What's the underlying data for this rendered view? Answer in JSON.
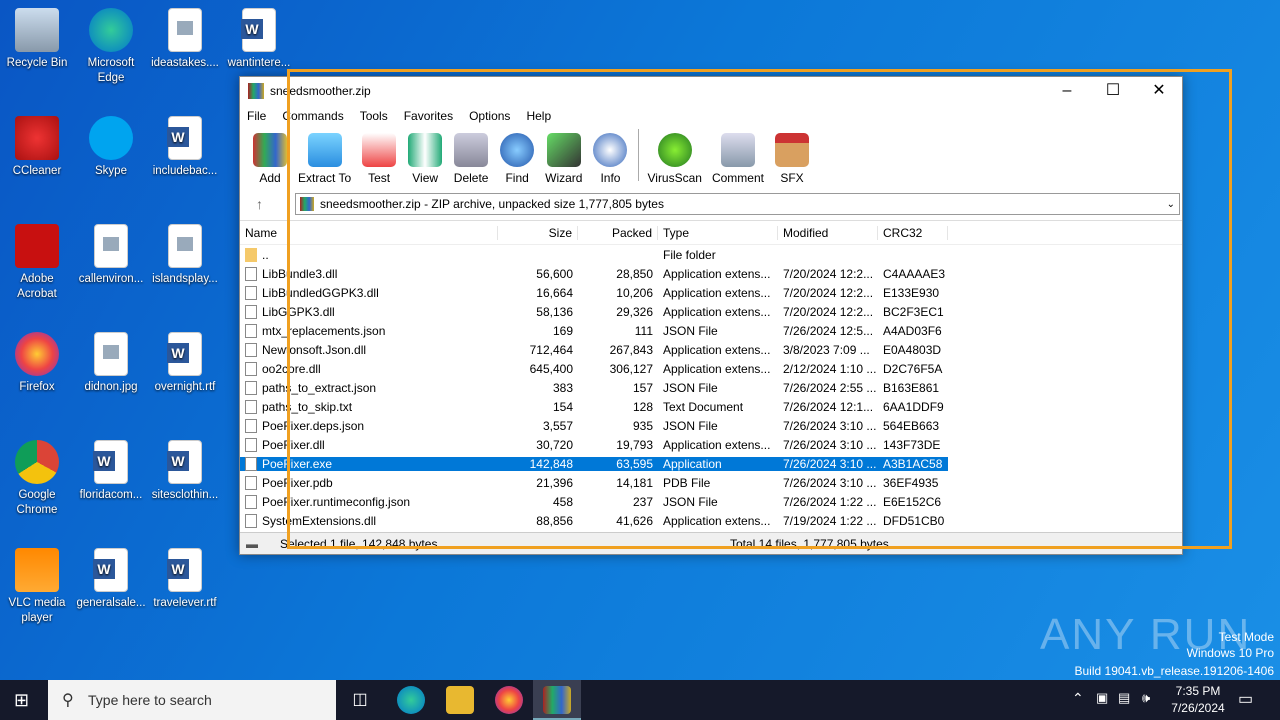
{
  "desktop": {
    "icons": [
      {
        "label": "Recycle Bin",
        "icon": "recycle-bin-icon"
      },
      {
        "label": "Microsoft Edge",
        "icon": "edge-icon"
      },
      {
        "label": "ideastakes....",
        "icon": "image-file-icon"
      },
      {
        "label": "wantintere...",
        "icon": "word-doc-icon"
      },
      {
        "label": "CCleaner",
        "icon": "ccleaner-icon"
      },
      {
        "label": "Skype",
        "icon": "skype-icon"
      },
      {
        "label": "includebac...",
        "icon": "word-doc-icon"
      },
      {
        "label": "Adobe Acrobat",
        "icon": "acrobat-icon"
      },
      {
        "label": "callenviron...",
        "icon": "image-file-icon"
      },
      {
        "label": "islandsplay...",
        "icon": "image-file-icon"
      },
      {
        "label": "Firefox",
        "icon": "firefox-icon"
      },
      {
        "label": "didnon.jpg",
        "icon": "image-file-icon"
      },
      {
        "label": "overnight.rtf",
        "icon": "word-doc-icon"
      },
      {
        "label": "Google Chrome",
        "icon": "chrome-icon"
      },
      {
        "label": "floridacom...",
        "icon": "word-doc-icon"
      },
      {
        "label": "sitesclothin...",
        "icon": "word-doc-icon"
      },
      {
        "label": "VLC media player",
        "icon": "vlc-icon"
      },
      {
        "label": "generalsale...",
        "icon": "word-doc-icon"
      },
      {
        "label": "travelever.rtf",
        "icon": "word-doc-icon"
      }
    ]
  },
  "window": {
    "title": "sneedsmoother.zip",
    "menu": [
      "File",
      "Commands",
      "Tools",
      "Favorites",
      "Options",
      "Help"
    ],
    "toolbar": [
      "Add",
      "Extract To",
      "Test",
      "View",
      "Delete",
      "Find",
      "Wizard",
      "Info",
      "VirusScan",
      "Comment",
      "SFX"
    ],
    "address": "sneedsmoother.zip - ZIP archive, unpacked size 1,777,805 bytes",
    "columns": [
      "Name",
      "Size",
      "Packed",
      "Type",
      "Modified",
      "CRC32"
    ],
    "rows": [
      [
        "..",
        "",
        "",
        "File folder",
        "",
        ""
      ],
      [
        "LibBundle3.dll",
        "56,600",
        "28,850",
        "Application extens...",
        "7/20/2024 12:2...",
        "C4AAAAE3"
      ],
      [
        "LibBundledGGPK3.dll",
        "16,664",
        "10,206",
        "Application extens...",
        "7/20/2024 12:2...",
        "E133E930"
      ],
      [
        "LibGGPK3.dll",
        "58,136",
        "29,326",
        "Application extens...",
        "7/20/2024 12:2...",
        "BC2F3EC1"
      ],
      [
        "mtx_replacements.json",
        "169",
        "111",
        "JSON File",
        "7/26/2024 12:5...",
        "A4AD03F6"
      ],
      [
        "Newtonsoft.Json.dll",
        "712,464",
        "267,843",
        "Application extens...",
        "3/8/2023 7:09 ...",
        "E0A4803D"
      ],
      [
        "oo2core.dll",
        "645,400",
        "306,127",
        "Application extens...",
        "2/12/2024 1:10 ...",
        "D2C76F5A"
      ],
      [
        "paths_to_extract.json",
        "383",
        "157",
        "JSON File",
        "7/26/2024 2:55 ...",
        "B163E861"
      ],
      [
        "paths_to_skip.txt",
        "154",
        "128",
        "Text Document",
        "7/26/2024 12:1...",
        "6AA1DDF9"
      ],
      [
        "PoeFixer.deps.json",
        "3,557",
        "935",
        "JSON File",
        "7/26/2024 3:10 ...",
        "564EB663"
      ],
      [
        "PoeFixer.dll",
        "30,720",
        "19,793",
        "Application extens...",
        "7/26/2024 3:10 ...",
        "143F73DE"
      ],
      [
        "PoeFixer.exe",
        "142,848",
        "63,595",
        "Application",
        "7/26/2024 3:10 ...",
        "A3B1AC58"
      ],
      [
        "PoeFixer.pdb",
        "21,396",
        "14,181",
        "PDB File",
        "7/26/2024 3:10 ...",
        "36EF4935"
      ],
      [
        "PoeFixer.runtimeconfig.json",
        "458",
        "237",
        "JSON File",
        "7/26/2024 1:22 ...",
        "E6E152C6"
      ],
      [
        "SystemExtensions.dll",
        "88,856",
        "41,626",
        "Application extens...",
        "7/19/2024 1:22 ...",
        "DFD51CB0"
      ]
    ],
    "selected_index": 11,
    "status_left": "Selected 1 file, 142,848 bytes",
    "status_right": "Total 14 files, 1,777,805 bytes"
  },
  "watermark": {
    "brand": "ANY RUN",
    "line1": "Test Mode",
    "line2": "Windows 10 Pro",
    "line3": "Build 19041.vb_release.191206-1406"
  },
  "taskbar": {
    "search_placeholder": "Type here to search",
    "time": "7:35 PM",
    "date": "7/26/2024"
  }
}
